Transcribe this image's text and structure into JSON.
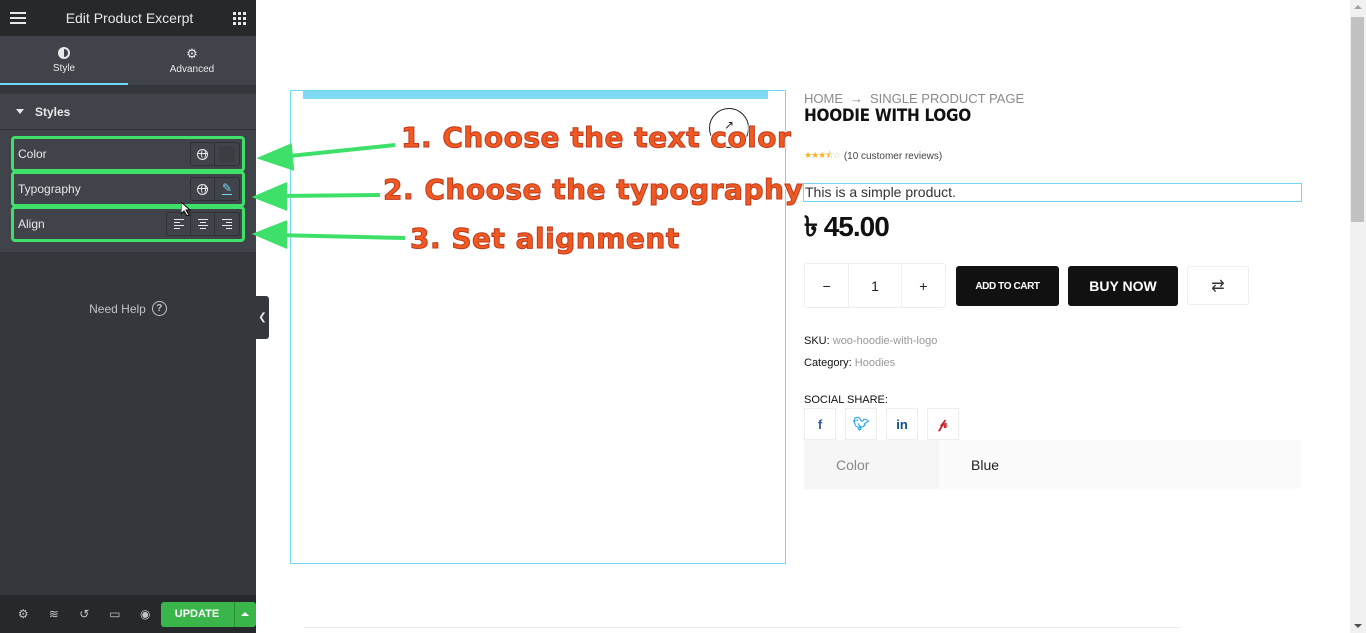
{
  "panel": {
    "title": "Edit Product Excerpt",
    "tabs": [
      {
        "label": "Style",
        "icon": "contrast-icon",
        "active": true
      },
      {
        "label": "Advanced",
        "icon": "gear-icon",
        "active": false
      }
    ],
    "section": "Styles",
    "controls": [
      {
        "label": "Color",
        "buttons": [
          "globe-icon",
          "color-swatch"
        ]
      },
      {
        "label": "Typography",
        "buttons": [
          "globe-icon",
          "pencil-icon"
        ]
      },
      {
        "label": "Align",
        "buttons": [
          "align-left-icon",
          "align-center-icon",
          "align-right-icon"
        ]
      }
    ],
    "need_help": "Need Help",
    "footer": {
      "icons": [
        "settings-icon",
        "layers-icon",
        "history-icon",
        "responsive-icon",
        "preview-icon"
      ],
      "update_label": "UPDATE"
    }
  },
  "annotations": [
    "1. Choose the text color",
    "2. Choose the typography",
    "3. Set alignment"
  ],
  "annotation_colors": {
    "text": "#f05a22",
    "arrow": "#3ee06a"
  },
  "product": {
    "breadcrumb": [
      "HOME",
      "SINGLE PRODUCT PAGE"
    ],
    "title": "HOODIE WITH LOGO",
    "rating_stars": 3.5,
    "rating_max": 5,
    "reviews": "(10 customer reviews)",
    "excerpt": "This is a simple product.",
    "price": "৳ 45.00",
    "quantity": "1",
    "qty_minus": "−",
    "qty_plus": "+",
    "add_to_cart": "ADD TO CART",
    "buy_now": "BUY NOW",
    "sku_label": "SKU:",
    "sku": "woo-hoodie-with-logo",
    "category_label": "Category:",
    "category": "Hoodies",
    "social_label": "SOCIAL SHARE:",
    "social": [
      "facebook-icon",
      "twitter-icon",
      "linkedin-icon",
      "pinterest-icon"
    ],
    "attributes": [
      {
        "key": "Color",
        "value": "Blue"
      }
    ]
  },
  "colors": {
    "accent": "#71d7f7",
    "update": "#39b54a",
    "panel_bg": "#34383c"
  }
}
